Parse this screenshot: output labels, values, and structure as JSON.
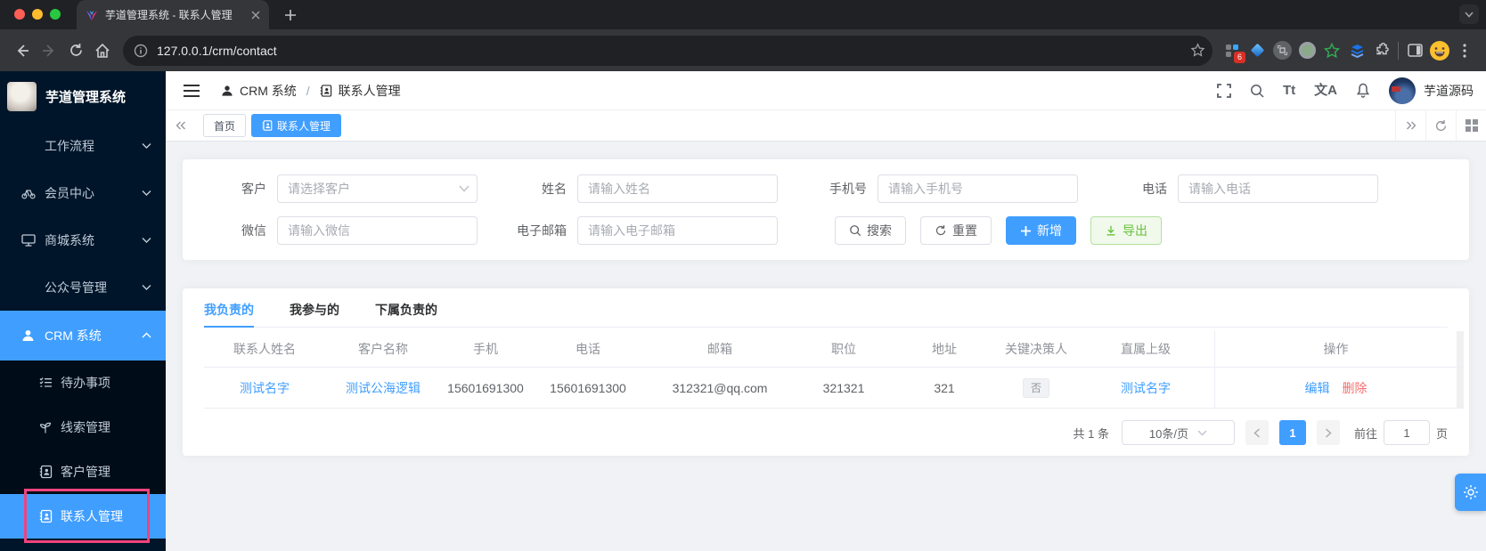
{
  "browser": {
    "tab_title": "芋道管理系统 - 联系人管理",
    "url": "127.0.0.1/crm/contact",
    "extension_badge": "6"
  },
  "sidebar": {
    "logo_title": "芋道管理系统",
    "menu": [
      {
        "label": "工作流程"
      },
      {
        "label": "会员中心"
      },
      {
        "label": "商城系统"
      },
      {
        "label": "公众号管理"
      },
      {
        "label": "CRM 系统"
      }
    ],
    "submenu": [
      {
        "label": "待办事项"
      },
      {
        "label": "线索管理"
      },
      {
        "label": "客户管理"
      },
      {
        "label": "联系人管理"
      }
    ]
  },
  "navbar": {
    "breadcrumb": {
      "parent": "CRM 系统",
      "separator": "/",
      "current": "联系人管理"
    },
    "size_icon_text": "Tt",
    "lang_icon_text": "文A",
    "username": "芋道源码"
  },
  "tagsbar": {
    "tags": [
      {
        "label": "首页"
      },
      {
        "label": "联系人管理"
      }
    ]
  },
  "filter": {
    "fields": [
      {
        "label": "客户",
        "placeholder": "请选择客户"
      },
      {
        "label": "姓名",
        "placeholder": "请输入姓名"
      },
      {
        "label": "手机号",
        "placeholder": "请输入手机号"
      },
      {
        "label": "电话",
        "placeholder": "请输入电话"
      },
      {
        "label": "微信",
        "placeholder": "请输入微信"
      },
      {
        "label": "电子邮箱",
        "placeholder": "请输入电子邮箱"
      }
    ],
    "buttons": {
      "search": "搜索",
      "reset": "重置",
      "create": "新增",
      "export": "导出"
    }
  },
  "tabs": [
    {
      "label": "我负责的"
    },
    {
      "label": "我参与的"
    },
    {
      "label": "下属负责的"
    }
  ],
  "table": {
    "columns": [
      "联系人姓名",
      "客户名称",
      "手机",
      "电话",
      "邮箱",
      "职位",
      "地址",
      "关键决策人",
      "直属上级",
      "操作"
    ],
    "rows": [
      {
        "name": "测试名字",
        "customer_name": "测试公海逻辑",
        "mobile": "15601691300",
        "telephone": "15601691300",
        "email": "312321@qq.com",
        "post": "321321",
        "address": "321",
        "master": "否",
        "parent": "测试名字",
        "edit": "编辑",
        "delete": "删除"
      }
    ]
  },
  "pagination": {
    "total": "共 1 条",
    "page_size": "10条/页",
    "page": "1",
    "goto_label": "前往",
    "goto_value": "1",
    "page_unit": "页"
  },
  "colors": {
    "primary": "#409eff",
    "success": "#67c23a",
    "danger": "#f56c6c",
    "sidebar_bg": "#001529",
    "highlight_box": "#f0437f"
  }
}
